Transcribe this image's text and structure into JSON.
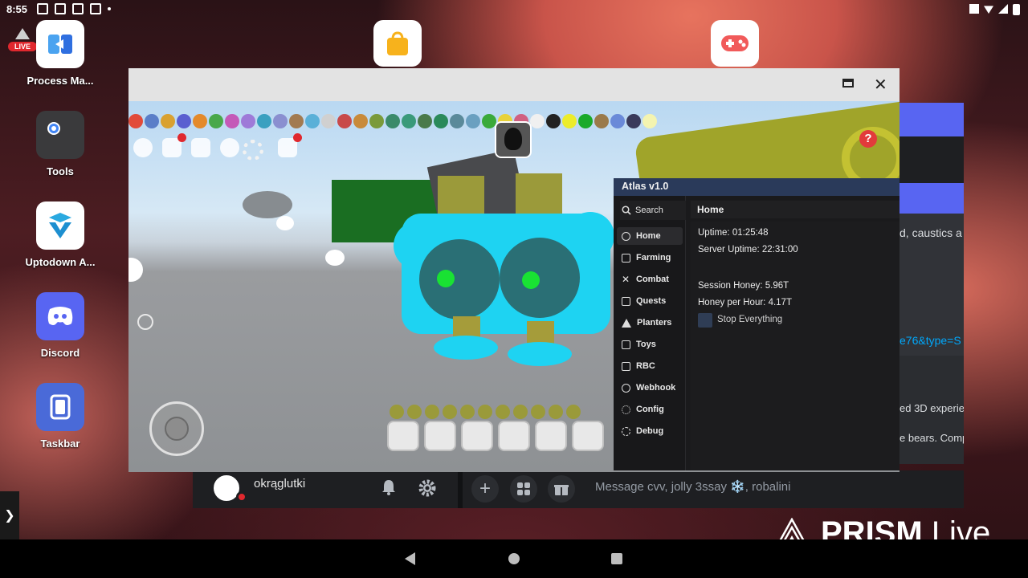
{
  "status_bar": {
    "time": "8:55"
  },
  "desktop_apps": [
    {
      "label": "Process Ma...",
      "icon": "process-manager-icon"
    },
    {
      "label": "Tools",
      "icon": "tools-folder-icon"
    },
    {
      "label": "Uptodown A...",
      "icon": "uptodown-icon"
    },
    {
      "label": "Discord",
      "icon": "discord-icon"
    },
    {
      "label": "Taskbar",
      "icon": "taskbar-icon"
    }
  ],
  "live_badge": "LIVE",
  "discord": {
    "username": "okrąglutki",
    "message_placeholder": "Message cvv, jolly 3ssay ❄️, robalini",
    "right_snippets": {
      "line1": "d, caustics a",
      "link": "e76&type=S",
      "line2": "ed 3D experie",
      "line3": "e bears. Comp"
    }
  },
  "atlas": {
    "title": "Atlas v1.0",
    "search_label": "Search",
    "nav": [
      "Home",
      "Farming",
      "Combat",
      "Quests",
      "Planters",
      "Toys",
      "RBC",
      "Webhook",
      "Config",
      "Debug"
    ],
    "active": "Home",
    "header": "Home",
    "uptime": "Uptime: 01:25:48",
    "server_uptime": "Server Uptime: 22:31:00",
    "session_honey": "Session Honey: 5.96T",
    "honey_per_hour": "Honey per Hour: 4.17T",
    "stop_label": "Stop Everything"
  },
  "prism": {
    "brand": "PRISM",
    "suffix": "Live"
  },
  "colors": {
    "atlas_title_bar": "#2a3a5a",
    "discord_blurple": "#5865f2",
    "bee_cyan": "#1ed3f2"
  }
}
